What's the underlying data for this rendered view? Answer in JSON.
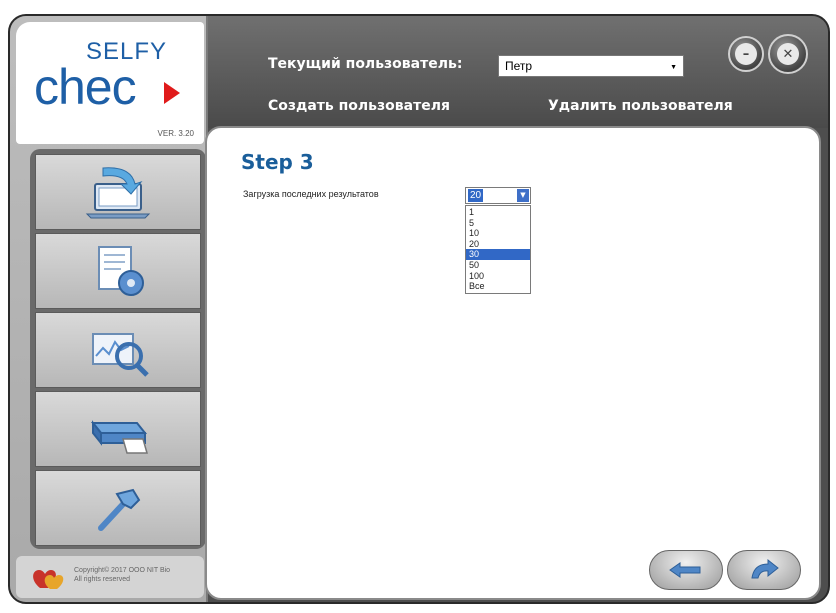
{
  "logo": {
    "line1": "SELFY",
    "line2": "chec",
    "version": "VER. 3.20"
  },
  "header": {
    "current_user_label": "Текущий пользователь:",
    "current_user_value": "Петр",
    "create_user": "Создать пользователя",
    "delete_user": "Удалить пользователя"
  },
  "window_buttons": {
    "minimize": "–",
    "close": "✕"
  },
  "sidebar": {
    "items": [
      {
        "icon": "laptop-download-icon"
      },
      {
        "icon": "document-settings-icon"
      },
      {
        "icon": "chart-search-icon"
      },
      {
        "icon": "printer-icon"
      },
      {
        "icon": "hammer-tools-icon"
      }
    ],
    "copyright": "Copyright© 2017 OOO NIT Bio\nAll rights reserved"
  },
  "main": {
    "step_title": "Step 3",
    "field_label": "Загрузка последних результатов",
    "combo_value": "20",
    "options": [
      "1",
      "5",
      "10",
      "20",
      "30",
      "50",
      "100",
      "Все"
    ],
    "highlighted_option": "30"
  },
  "colors": {
    "accent": "#1a5e9a",
    "selection": "#3168c6",
    "logo_red": "#e01b1b",
    "chrome": "#4e4e4e"
  }
}
